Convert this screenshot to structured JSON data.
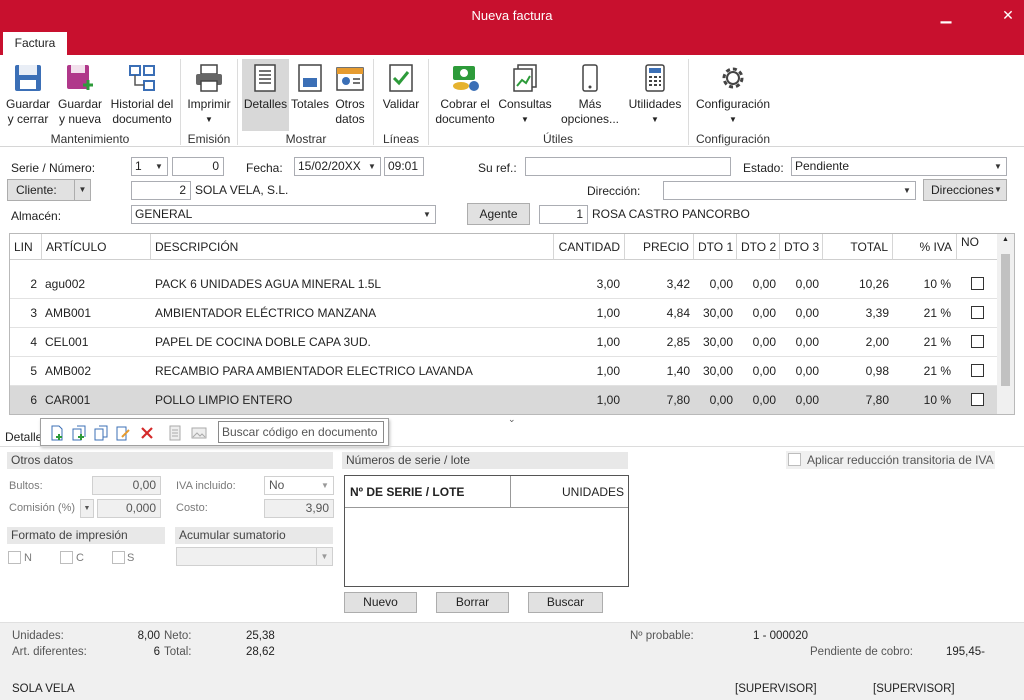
{
  "window": {
    "title": "Nueva factura",
    "minimize": "▁",
    "close": "✕"
  },
  "tabs": {
    "factura": "Factura"
  },
  "ribbon": {
    "guardar_cerrar": [
      "Guardar",
      "y cerrar"
    ],
    "guardar_nueva": [
      "Guardar",
      "y nueva"
    ],
    "historial": [
      "Historial del",
      "documento"
    ],
    "imprimir": "Imprimir",
    "detalles": "Detalles",
    "totales": "Totales",
    "otros_datos": [
      "Otros",
      "datos"
    ],
    "validar": "Validar",
    "cobrar": [
      "Cobrar el",
      "documento"
    ],
    "consultas": "Consultas",
    "mas_opciones": [
      "Más",
      "opciones..."
    ],
    "utilidades": "Utilidades",
    "configuracion": "Configuración",
    "groups": {
      "mantenimiento": "Mantenimiento",
      "emision": "Emisión",
      "mostrar": "Mostrar",
      "lineas": "Líneas",
      "utiles": "Útiles",
      "configuracion": "Configuración"
    }
  },
  "header": {
    "serie_label": "Serie / Número:",
    "serie_value": "1",
    "numero_value": "0",
    "fecha_label": "Fecha:",
    "fecha_value": "15/02/20XX",
    "hora_value": "09:01",
    "suref_label": "Su ref.:",
    "suref_value": "",
    "estado_label": "Estado:",
    "estado_value": "Pendiente",
    "cliente_label": "Cliente:",
    "cliente_code": "2",
    "cliente_name": "SOLA VELA, S.L.",
    "direccion_label": "Dirección:",
    "direccion_value": "",
    "direcciones_button": "Direcciones",
    "almacen_label": "Almacén:",
    "almacen_value": "GENERAL",
    "agente_button": "Agente",
    "agente_code": "1",
    "agente_name": "ROSA CASTRO PANCORBO"
  },
  "grid": {
    "columns": [
      "LIN",
      "ARTÍCULO",
      "DESCRIPCIÓN",
      "CANTIDAD",
      "PRECIO",
      "DTO 1",
      "DTO 2",
      "DTO 3",
      "TOTAL",
      "% IVA",
      "NO"
    ],
    "rows": [
      {
        "lin": "2",
        "articulo": "agu002",
        "descripcion": "PACK 6 UNIDADES AGUA MINERAL 1.5L",
        "cantidad": "3,00",
        "precio": "3,42",
        "dto1": "0,00",
        "dto2": "0,00",
        "dto3": "0,00",
        "total": "10,26",
        "iva": "10 %",
        "no": false
      },
      {
        "lin": "3",
        "articulo": "AMB001",
        "descripcion": "AMBIENTADOR ELÉCTRICO MANZANA",
        "cantidad": "1,00",
        "precio": "4,84",
        "dto1": "30,00",
        "dto2": "0,00",
        "dto3": "0,00",
        "total": "3,39",
        "iva": "21 %",
        "no": false
      },
      {
        "lin": "4",
        "articulo": "CEL001",
        "descripcion": "PAPEL DE COCINA DOBLE CAPA 3UD.",
        "cantidad": "1,00",
        "precio": "2,85",
        "dto1": "30,00",
        "dto2": "0,00",
        "dto3": "0,00",
        "total": "2,00",
        "iva": "21 %",
        "no": false
      },
      {
        "lin": "5",
        "articulo": "AMB002",
        "descripcion": "RECAMBIO PARA AMBIENTADOR ELECTRICO LAVANDA",
        "cantidad": "1,00",
        "precio": "1,40",
        "dto1": "30,00",
        "dto2": "0,00",
        "dto3": "0,00",
        "total": "0,98",
        "iva": "21 %",
        "no": false
      },
      {
        "lin": "6",
        "articulo": "CAR001",
        "descripcion": "POLLO LIMPIO ENTERO",
        "cantidad": "1,00",
        "precio": "7,80",
        "dto1": "0,00",
        "dto2": "0,00",
        "dto3": "0,00",
        "total": "7,80",
        "iva": "10 %",
        "no": false
      }
    ]
  },
  "lines_toolbar": {
    "search_placeholder": "Buscar código en documento",
    "tab_label": "Detalle"
  },
  "detail": {
    "otros_datos": "Otros datos",
    "bultos_label": "Bultos:",
    "bultos_value": "0,00",
    "iva_incluido_label": "IVA incluido:",
    "iva_incluido_value": "No",
    "comision_label": "Comisión (%)",
    "comision_value": "0,000",
    "costo_label": "Costo:",
    "costo_value": "3,90",
    "formato_label": "Formato de impresión",
    "formato_opts": [
      "N",
      "C",
      "S"
    ],
    "acumular_label": "Acumular sumatorio",
    "serie_lote_label": "Números de serie / lote",
    "serie_col": "Nº DE SERIE / LOTE",
    "unidades_col": "UNIDADES",
    "nuevo": "Nuevo",
    "borrar": "Borrar",
    "buscar": "Buscar",
    "reduccion_label": "Aplicar reducción transitoria de IVA"
  },
  "footer": {
    "unidades_label": "Unidades:",
    "unidades_value": "8,00",
    "art_label": "Art. diferentes:",
    "art_value": "6",
    "neto_label": "Neto:",
    "neto_value": "25,38",
    "total_label": "Total:",
    "total_value": "28,62",
    "nprobable_label": "Nº probable:",
    "nprobable_value": "1 - 000020",
    "pendiente_label": "Pendiente de cobro:",
    "pendiente_value": "195,45-",
    "company": "SOLA VELA",
    "user1": "[SUPERVISOR]",
    "user2": "[SUPERVISOR]"
  }
}
